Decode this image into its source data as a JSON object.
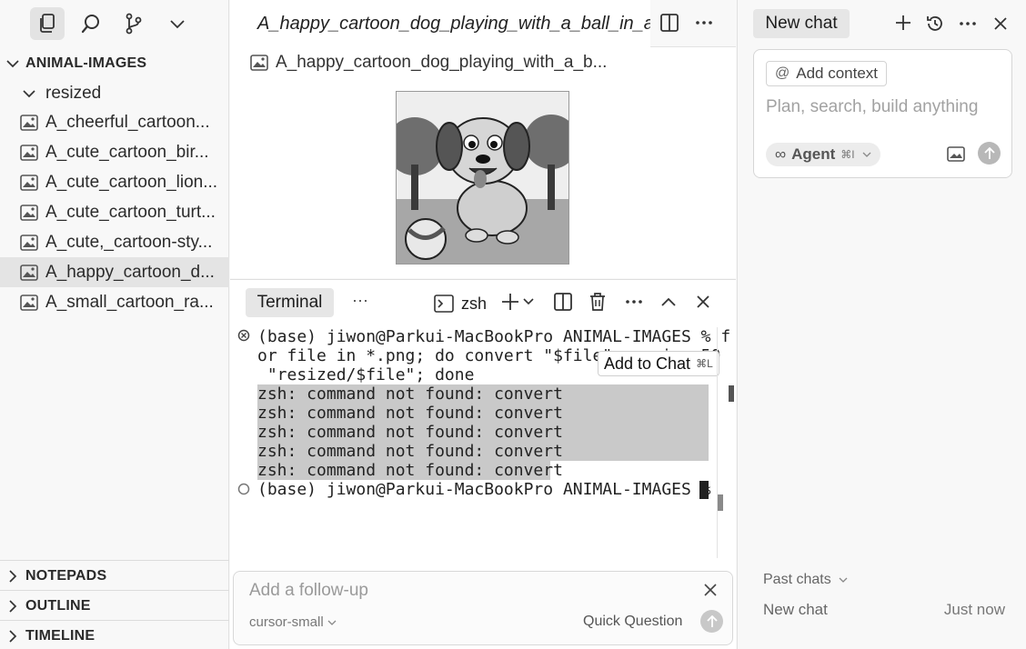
{
  "sidebar": {
    "folder": "ANIMAL-IMAGES",
    "subfolder": "resized",
    "files": [
      "A_cheerful_cartoon...",
      "A_cute_cartoon_bir...",
      "A_cute_cartoon_lion...",
      "A_cute_cartoon_turt...",
      "A_cute,_cartoon-sty...",
      "A_happy_cartoon_d...",
      "A_small_cartoon_ra..."
    ],
    "selected_index": 5,
    "sections": [
      "NOTEPADS",
      "OUTLINE",
      "TIMELINE"
    ]
  },
  "editor": {
    "tab_title": "A_happy_cartoon_dog_playing_with_a_ball_in_a",
    "breadcrumb": "A_happy_cartoon_dog_playing_with_a_b..."
  },
  "panel": {
    "tab": "Terminal",
    "more": "···",
    "shell": "zsh",
    "terminal_lines": [
      "(base) jiwon@Parkui-MacBookPro ANIMAL-IMAGES % f",
      "or file in *.png; do convert \"$file\" -resize 50",
      " \"resized/$file\"; done",
      "zsh: command not found: convert",
      "zsh: command not found: convert",
      "zsh: command not found: convert",
      "zsh: command not found: convert",
      "zsh: command not found: convert",
      "(base) jiwon@Parkui-MacBookPro ANIMAL-IMAGES % "
    ],
    "tooltip": {
      "label": "Add to Chat",
      "shortcut": "⌘L"
    },
    "followup_placeholder": "Add a follow-up",
    "model": "cursor-small",
    "quick_question": "Quick Question"
  },
  "chat": {
    "tab": "New chat",
    "add_context": "Add context",
    "placeholder": "Plan, search, build anything",
    "agent": "Agent",
    "agent_shortcut": "⌘I",
    "past_chats_label": "Past chats",
    "past_chats": [
      {
        "title": "New chat",
        "time": "Just now"
      }
    ]
  },
  "colors": {
    "selection": "#e4e4e4",
    "highlight": "#c9c9c9",
    "accent_gray": "#b8b8b8"
  }
}
